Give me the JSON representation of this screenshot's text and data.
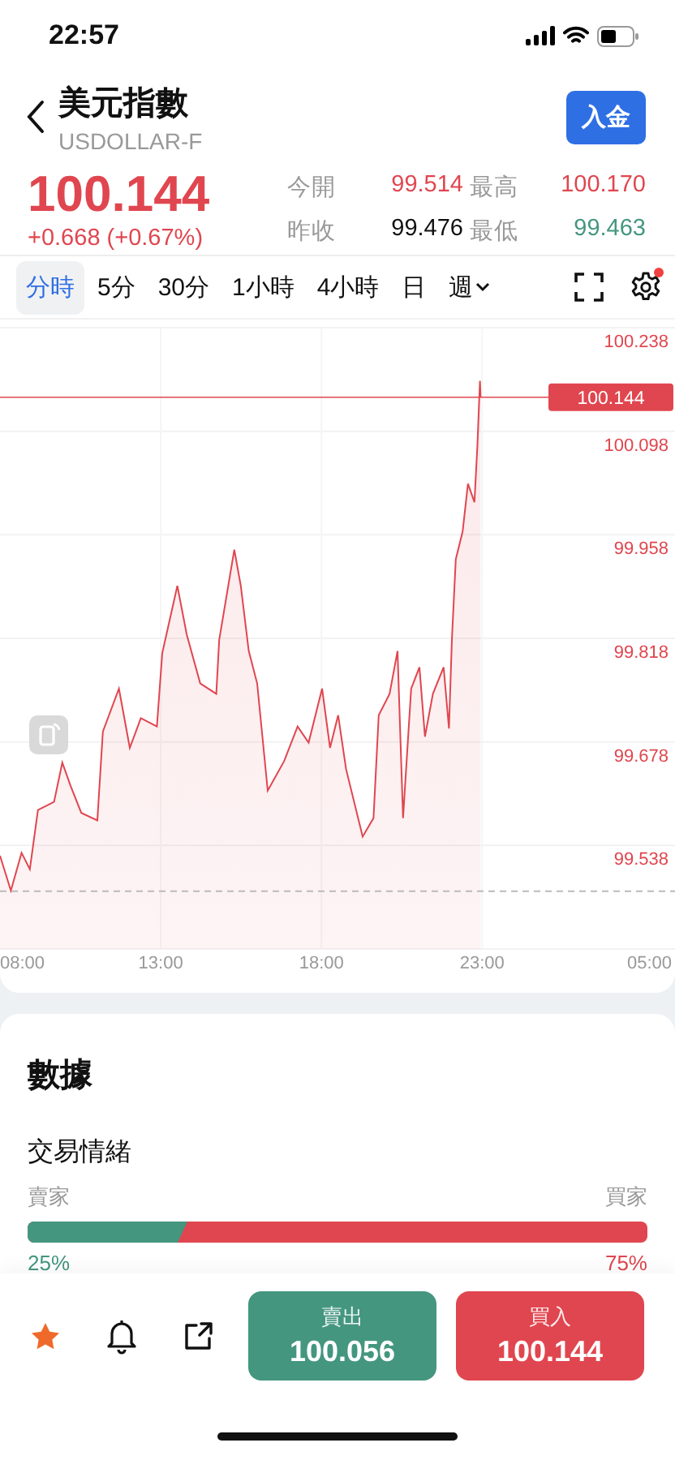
{
  "status_bar": {
    "time": "22:57"
  },
  "header": {
    "title": "美元指數",
    "symbol": "USDOLLAR-F",
    "deposit_button": "入金"
  },
  "quote": {
    "price": "100.144",
    "change": "+0.668 (+0.67%)",
    "stats": [
      {
        "label": "今開",
        "value": "99.514",
        "color": "#e0464f"
      },
      {
        "label": "最高",
        "value": "100.170",
        "color": "#e0464f"
      },
      {
        "label": "昨收",
        "value": "99.476",
        "color": "#111111"
      },
      {
        "label": "最低",
        "value": "99.463",
        "color": "#44967f"
      }
    ]
  },
  "periods": [
    {
      "label": "分時",
      "selected": true,
      "kind": "tab"
    },
    {
      "label": "5分",
      "selected": false,
      "kind": "tab"
    },
    {
      "label": "30分",
      "selected": false,
      "kind": "tab"
    },
    {
      "label": "1小時",
      "selected": false,
      "kind": "tab"
    },
    {
      "label": "4小時",
      "selected": false,
      "kind": "tab"
    },
    {
      "label": "日",
      "selected": false,
      "kind": "tab"
    },
    {
      "label": "週",
      "selected": false,
      "kind": "dropdown"
    }
  ],
  "settings_badge": true,
  "chart": {
    "chart_data": {
      "type": "area",
      "grid": true,
      "x": [
        8.0,
        8.34,
        8.67,
        8.93,
        9.18,
        9.68,
        9.94,
        10.19,
        10.53,
        11.03,
        11.2,
        11.7,
        12.04,
        12.38,
        12.88,
        13.05,
        13.52,
        13.81,
        14.23,
        14.73,
        14.82,
        15.29,
        15.49,
        15.74,
        16.0,
        16.33,
        16.84,
        17.26,
        17.6,
        18.02,
        18.27,
        18.52,
        18.77,
        19.28,
        19.62,
        19.78,
        20.12,
        20.37,
        20.54,
        20.79,
        21.05,
        21.22,
        21.47,
        21.8,
        21.97,
        22.06,
        22.18,
        22.39,
        22.56,
        22.76,
        22.85,
        22.93,
        22.95
      ],
      "series": [
        {
          "color": "#e0464f",
          "values": [
            99.524,
            99.477,
            99.528,
            99.506,
            99.586,
            99.597,
            99.65,
            99.619,
            99.582,
            99.572,
            99.692,
            99.75,
            99.67,
            99.71,
            99.699,
            99.798,
            99.889,
            99.823,
            99.757,
            99.743,
            99.816,
            99.938,
            99.889,
            99.801,
            99.757,
            99.612,
            99.652,
            99.699,
            99.677,
            99.75,
            99.67,
            99.714,
            99.641,
            99.55,
            99.575,
            99.714,
            99.743,
            99.801,
            99.575,
            99.75,
            99.779,
            99.685,
            99.743,
            99.779,
            99.696,
            99.816,
            99.925,
            99.962,
            100.027,
            100.002,
            100.078,
            100.166,
            100.144
          ]
        }
      ],
      "xlim": [
        8,
        29
      ],
      "ylim": [
        99.398,
        100.238
      ],
      "xticks": [
        {
          "value": 8,
          "label": "08:00"
        },
        {
          "value": 13,
          "label": "13:00"
        },
        {
          "value": 18,
          "label": "18:00"
        },
        {
          "value": 23,
          "label": "23:00"
        }
      ],
      "yticks": [
        {
          "value": 100.238,
          "label": "100.238"
        },
        {
          "value": 100.098,
          "label": "100.098"
        },
        {
          "value": 99.958,
          "label": "99.958"
        },
        {
          "value": 99.818,
          "label": "99.818"
        },
        {
          "value": 99.678,
          "label": "99.678"
        },
        {
          "value": 99.538,
          "label": "99.538"
        }
      ],
      "ref_lines": [
        {
          "axis": "y",
          "value": 100.144,
          "label": "100.144"
        },
        {
          "axis": "y",
          "value": 99.476
        }
      ]
    },
    "x_axis_end_label": "05:00"
  },
  "data_card": {
    "title": "數據",
    "sentiment": {
      "title": "交易情緒",
      "sell_label": "賣家",
      "buy_label": "買家",
      "level": 0.25,
      "sell_pct": "25%",
      "buy_pct": "75%"
    }
  },
  "trade_bar": {
    "favorite": true,
    "sell": {
      "label": "賣出",
      "price": "100.056"
    },
    "buy": {
      "label": "買入",
      "price": "100.144"
    }
  }
}
